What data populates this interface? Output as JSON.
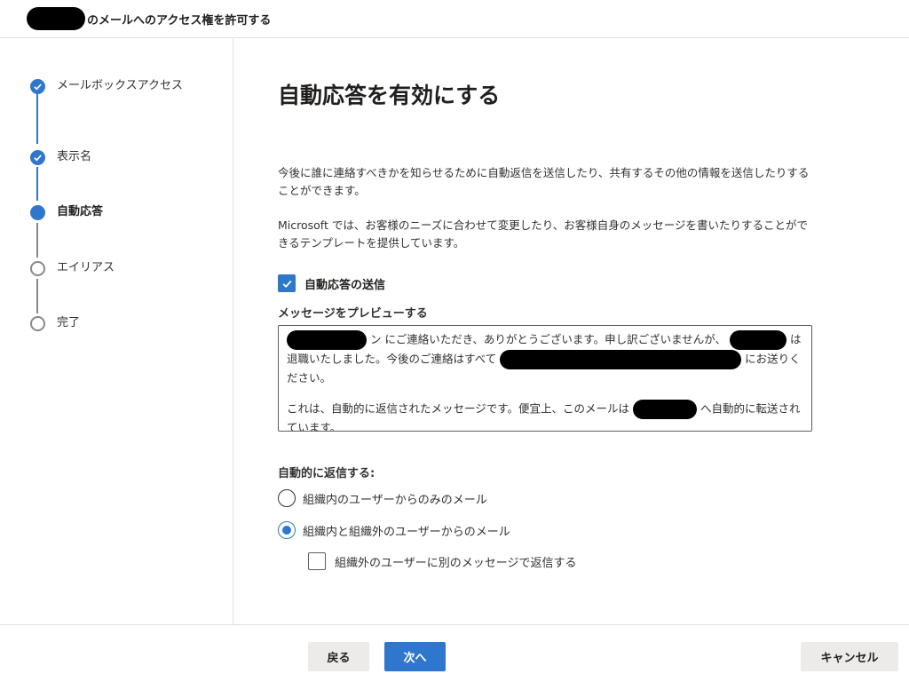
{
  "header": {
    "title": "のメールへのアクセス権を許可する"
  },
  "wizard_steps": [
    {
      "label": "メールボックスアクセス",
      "state": "done"
    },
    {
      "label": "表示名",
      "state": "done"
    },
    {
      "label": "自動応答",
      "state": "current"
    },
    {
      "label": "エイリアス",
      "state": "pending"
    },
    {
      "label": "完了",
      "state": "pending"
    }
  ],
  "main": {
    "title": "自動応答を有効にする",
    "paragraph1": "今後に誰に連絡すべきかを知らせるために自動返信を送信したり、共有するその他の情報を送信したりすることができます。",
    "paragraph2": "Microsoft では、お客様のニーズに合わせて変更したり、お客様自身のメッセージを書いたりすることができるテンプレートを提供しています。",
    "send_auto_reply_label": "自動応答の送信",
    "send_auto_reply_checked": true,
    "preview_label": "メッセージをプレビューする",
    "preview": {
      "line1_part1": "ン にご連絡いただき、ありがとうございます。申し訳ございませんが、",
      "line1_part2": "は退職いたしました。今後のご連絡はすべて",
      "line1_part3": "にお送りください。",
      "line2_part1": "これは、自動的に返信されたメッセージです。便宜上、このメールは",
      "line2_part2": "へ自動的に転送されています。"
    },
    "auto_reply_to_label": "自動的に返信する:",
    "radio_options": [
      {
        "label": "組織内のユーザーからのみのメール",
        "selected": false
      },
      {
        "label": "組織内と組織外のユーザーからのメール",
        "selected": true
      }
    ],
    "external_separate_label": "組織外のユーザーに別のメッセージで返信する",
    "external_separate_checked": false
  },
  "footer": {
    "back_label": "戻る",
    "next_label": "次へ",
    "cancel_label": "キャンセル"
  },
  "colors": {
    "accent": "#2f77cc",
    "border": "#e1dfdd",
    "button_secondary": "#edebe9"
  }
}
